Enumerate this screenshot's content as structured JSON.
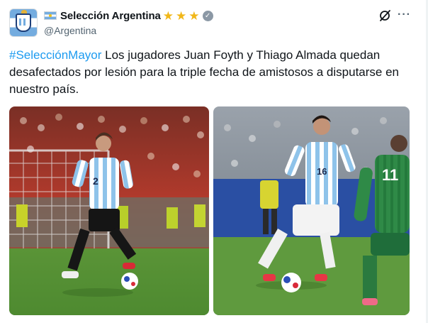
{
  "account": {
    "display_name": "Selección Argentina",
    "handle": "@Argentina",
    "stars": [
      "★",
      "★",
      "★"
    ],
    "verified_glyph": "✓",
    "flag_icon": "argentina-flag-icon",
    "avatar_icon": "afa-crest-icon"
  },
  "actions": {
    "more_glyph": "···",
    "grok_icon": "grok-icon"
  },
  "tweet": {
    "hashtag": "#SelecciónMayor",
    "body": " Los jugadores Juan Foyth y Thiago Almada quedan desafectados por lesión para la triple fecha de amistosos a disputarse en nuestro país."
  },
  "media": [
    {
      "alt_icon": "photo-player-2-dribbling",
      "jersey_number": "2"
    },
    {
      "alt_icon": "photo-player-16-dribbling",
      "jersey_number": "16",
      "opponent_number": "11"
    }
  ],
  "colors": {
    "link": "#1d9bf0",
    "text": "#0f1419",
    "muted": "#536471",
    "star": "#f1b719",
    "albiceleste": "#74acdf",
    "pitch": "#5f9a3e"
  }
}
